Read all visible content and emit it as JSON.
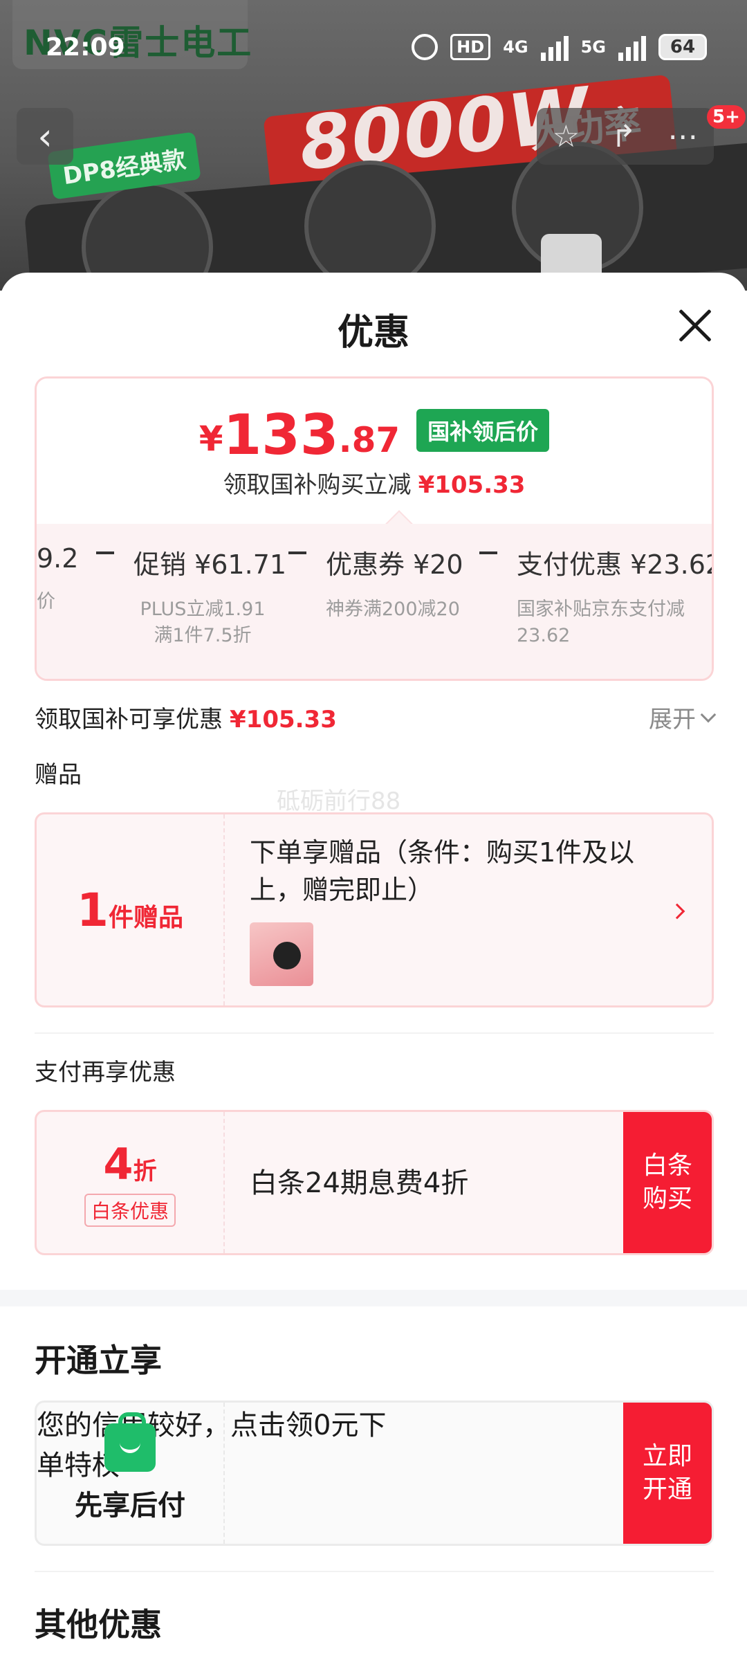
{
  "background": {
    "brand": "NVC雷士电工",
    "banner": "8000W",
    "banner_sub": "大功率",
    "model_tag": "DP8经典款"
  },
  "status_bar": {
    "time": "22:09",
    "hd": "HD",
    "net1": "4G",
    "net2": "5G",
    "battery": "64"
  },
  "nav": {
    "back_icon": "chevron-left-icon",
    "badge": "5+"
  },
  "sheet": {
    "title": "优惠",
    "price": {
      "yen": "¥",
      "integer": "133",
      "decimal": ".87",
      "tag": "国补领后价",
      "claim_text": "领取国补购买立减",
      "claim_amount": "¥105.33"
    },
    "breakdown": [
      {
        "heading": "9.2",
        "sub": "价"
      },
      {
        "heading": "促销 ¥61.71",
        "sub": "PLUS立减1.91 满1件7.5折"
      },
      {
        "heading": "优惠券 ¥20",
        "sub": "神券满200减20"
      },
      {
        "heading": "支付优惠 ¥23.62",
        "sub": "国家补贴京东支付减23.62"
      }
    ],
    "subsidy_row": {
      "label": "领取国补可享优惠",
      "amount": "¥105.33",
      "expand": "展开"
    },
    "gift_label": "赠品",
    "watermark": "砥砺前行88",
    "gift_card": {
      "count": "1",
      "unit": "件赠品",
      "desc": "下单享赠品（条件：购买1件及以上，赠完即止）"
    },
    "pay_label": "支付再享优惠",
    "baitiao_card": {
      "value": "4",
      "unit": "折",
      "tag": "白条优惠",
      "desc": "白条24期息费4折",
      "button": "白条购买"
    },
    "open_section": "开通立享",
    "credit_card": {
      "name": "先享后付",
      "desc": "您的信用较好，点击领0元下单特权",
      "button": "立即开通"
    },
    "other_section": "其他优惠"
  }
}
